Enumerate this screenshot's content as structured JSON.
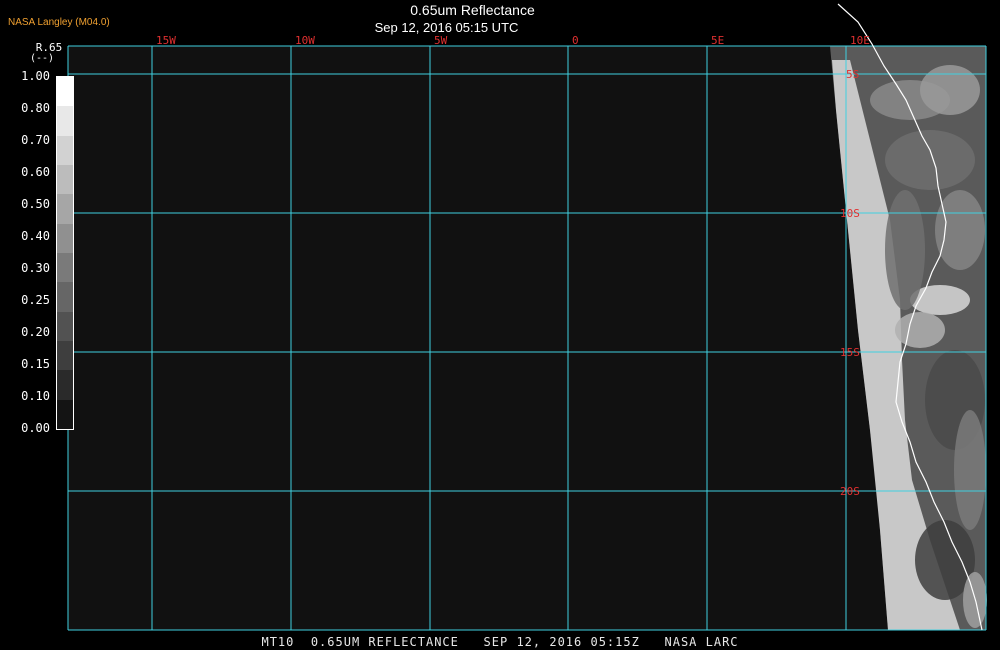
{
  "header": {
    "credit": "NASA Langley (M04.0)",
    "title": "0.65um Reflectance",
    "timestamp": "Sep 12, 2016 05:15 UTC"
  },
  "footer": {
    "caption": "MT10  0.65UM REFLECTANCE   SEP 12, 2016 05:15Z   NASA LARC"
  },
  "colorbar": {
    "title": "R.65",
    "unit": "(--)",
    "labels": [
      "1.00",
      "0.80",
      "0.70",
      "0.60",
      "0.50",
      "0.40",
      "0.30",
      "0.25",
      "0.20",
      "0.15",
      "0.10",
      "0.00"
    ],
    "colors": [
      "#ffffff",
      "#e8e8e8",
      "#d2d2d2",
      "#bcbcbc",
      "#a6a6a6",
      "#909090",
      "#7a7a7a",
      "#666666",
      "#525252",
      "#3e3e3e",
      "#2a2a2a",
      "#141414"
    ]
  },
  "map": {
    "longitude_labels": [
      "15W",
      "10W",
      "5W",
      "0",
      "5E",
      "10E"
    ],
    "latitude_labels": [
      "5S",
      "10S",
      "15S",
      "20S"
    ],
    "gridline_color": "#40d0e0",
    "label_color": "#e03030",
    "background_color": "#111111"
  }
}
